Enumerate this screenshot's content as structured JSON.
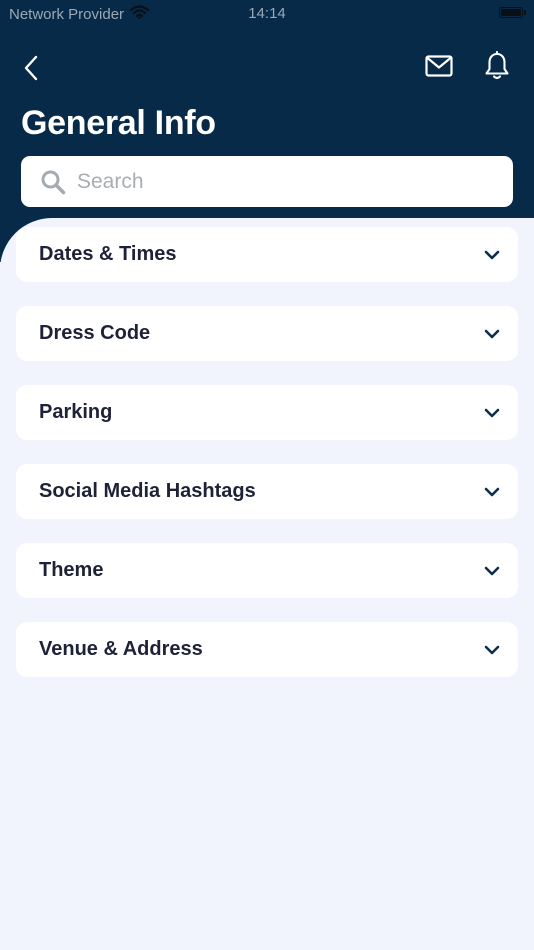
{
  "status_bar": {
    "carrier": "Network Provider",
    "time": "14:14",
    "battery_level": 1.0
  },
  "header": {
    "title": "General Info",
    "icons": {
      "back": "chevron-left-icon",
      "mail": "mail-icon",
      "notifications": "bell-icon"
    }
  },
  "search": {
    "placeholder": "Search",
    "value": ""
  },
  "sections": [
    {
      "label": "Dates & Times",
      "expanded": false
    },
    {
      "label": "Dress Code",
      "expanded": false
    },
    {
      "label": "Parking",
      "expanded": false
    },
    {
      "label": "Social Media Hashtags",
      "expanded": false
    },
    {
      "label": "Theme",
      "expanded": false
    },
    {
      "label": "Venue & Address",
      "expanded": false
    }
  ],
  "colors": {
    "header_bg": "#062a47",
    "content_bg": "#f1f4fc",
    "card_bg": "#ffffff",
    "text_dark": "#1d2236",
    "chevron": "#0d2f4f",
    "placeholder": "#a9aeb4"
  }
}
